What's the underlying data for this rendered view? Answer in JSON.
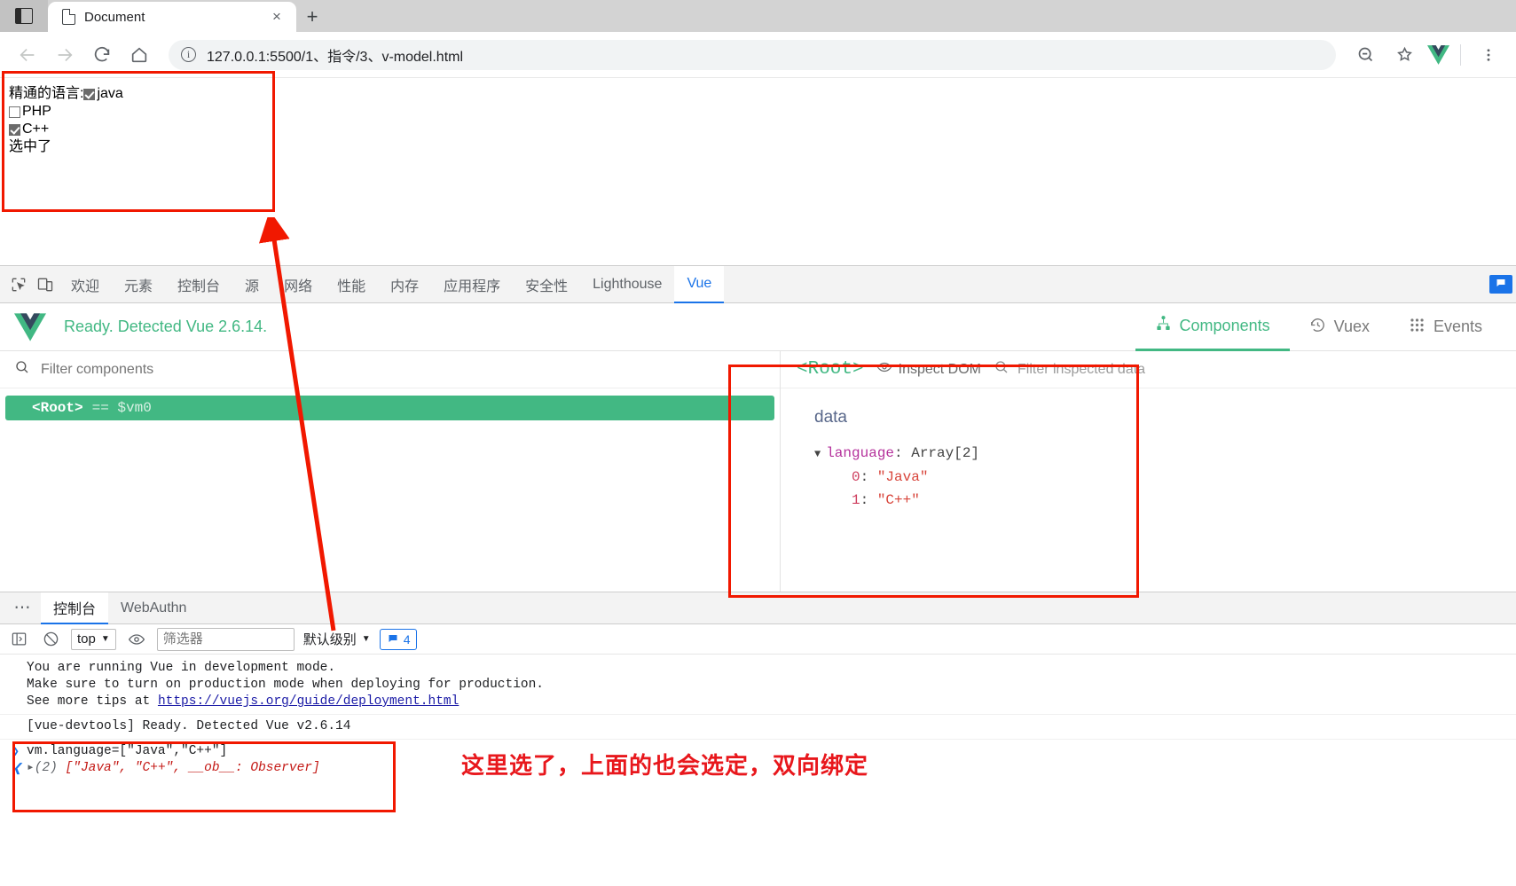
{
  "browser": {
    "tab": {
      "title": "Document",
      "close_label": "×",
      "icon": "document-icon"
    },
    "newtab_label": "+",
    "toolbar": {
      "back": "←",
      "forward": "→",
      "reload": "↻",
      "home": "⌂",
      "url": "127.0.0.1:5500/1、指令/3、v-model.html",
      "zoom_out": "zoom-out-icon",
      "bookmark": "bookmark-star-icon",
      "extension_vue": "V",
      "menu": "⋮"
    }
  },
  "page": {
    "label": "精通的语言:",
    "checkboxes": [
      {
        "label": "java",
        "checked": true
      },
      {
        "label": "PHP",
        "checked": false
      },
      {
        "label": "C++",
        "checked": true
      }
    ],
    "status": "选中了"
  },
  "annotations": {
    "note": "这里选了，上面的也会选定，双向绑定",
    "box_color": "#f11800"
  },
  "devtools": {
    "tabs": [
      {
        "label": "欢迎",
        "active": false
      },
      {
        "label": "元素",
        "active": false
      },
      {
        "label": "控制台",
        "active": false
      },
      {
        "label": "源",
        "active": false
      },
      {
        "label": "网络",
        "active": false
      },
      {
        "label": "性能",
        "active": false
      },
      {
        "label": "内存",
        "active": false
      },
      {
        "label": "应用程序",
        "active": false
      },
      {
        "label": "安全性",
        "active": false
      },
      {
        "label": "Lighthouse",
        "active": false
      },
      {
        "label": "Vue",
        "active": true
      }
    ],
    "inspect_icon": "inspect-element-icon",
    "device_icon": "device-toolbar-icon"
  },
  "vue": {
    "status": "Ready. Detected Vue 2.6.14.",
    "logo": "vue-logo",
    "tabs": [
      {
        "label": "Components",
        "icon": "components-icon",
        "active": true
      },
      {
        "label": "Vuex",
        "icon": "history-icon",
        "active": false
      },
      {
        "label": "Events",
        "icon": "grid-icon",
        "active": false
      }
    ],
    "filter_placeholder": "Filter components",
    "tree": [
      {
        "name": "<Root>",
        "vm": "== $vm0",
        "selected": true
      }
    ],
    "inspector": {
      "root_label": "<Root>",
      "inspect_dom": "Inspect DOM",
      "filter_placeholder": "Filter inspected data",
      "section_title": "data",
      "rows": [
        {
          "indent": 0,
          "triangle": "▼",
          "key": "language",
          "sep": ": ",
          "value": "Array[2]",
          "value_kind": "type"
        },
        {
          "indent": 1,
          "triangle": "",
          "key": "0",
          "sep": ": ",
          "value": "\"Java\"",
          "value_kind": "string"
        },
        {
          "indent": 1,
          "triangle": "",
          "key": "1",
          "sep": ": ",
          "value": "\"C++\"",
          "value_kind": "string"
        }
      ]
    }
  },
  "drawer": {
    "dots": "⋯",
    "tabs": [
      {
        "label": "控制台",
        "active": true
      },
      {
        "label": "WebAuthn",
        "active": false
      }
    ]
  },
  "console": {
    "toolbar": {
      "execute_icon": "execute-sidebar-icon",
      "clear_icon": "clear-console-icon",
      "context": "top",
      "eye_icon": "eye-icon",
      "filter_placeholder": "筛选器",
      "level": "默认级别",
      "issues_count": "4",
      "issues_icon": "message-icon"
    },
    "messages": [
      {
        "text": "You are running Vue in development mode.",
        "type": "plain"
      },
      {
        "text": "Make sure to turn on production mode when deploying for production.",
        "type": "plain"
      },
      {
        "text": "See more tips at ",
        "link": "https://vuejs.org/guide/deployment.html",
        "type": "link"
      },
      {
        "text": "[vue-devtools] Ready. Detected Vue v2.6.14",
        "type": "plain"
      }
    ],
    "input": "vm.language=[\"Java\",\"C++\"]",
    "result_prefix": "(2) ",
    "result": "[\"Java\", \"C++\", __ob__: Observer]",
    "result_arrow": "▸"
  }
}
